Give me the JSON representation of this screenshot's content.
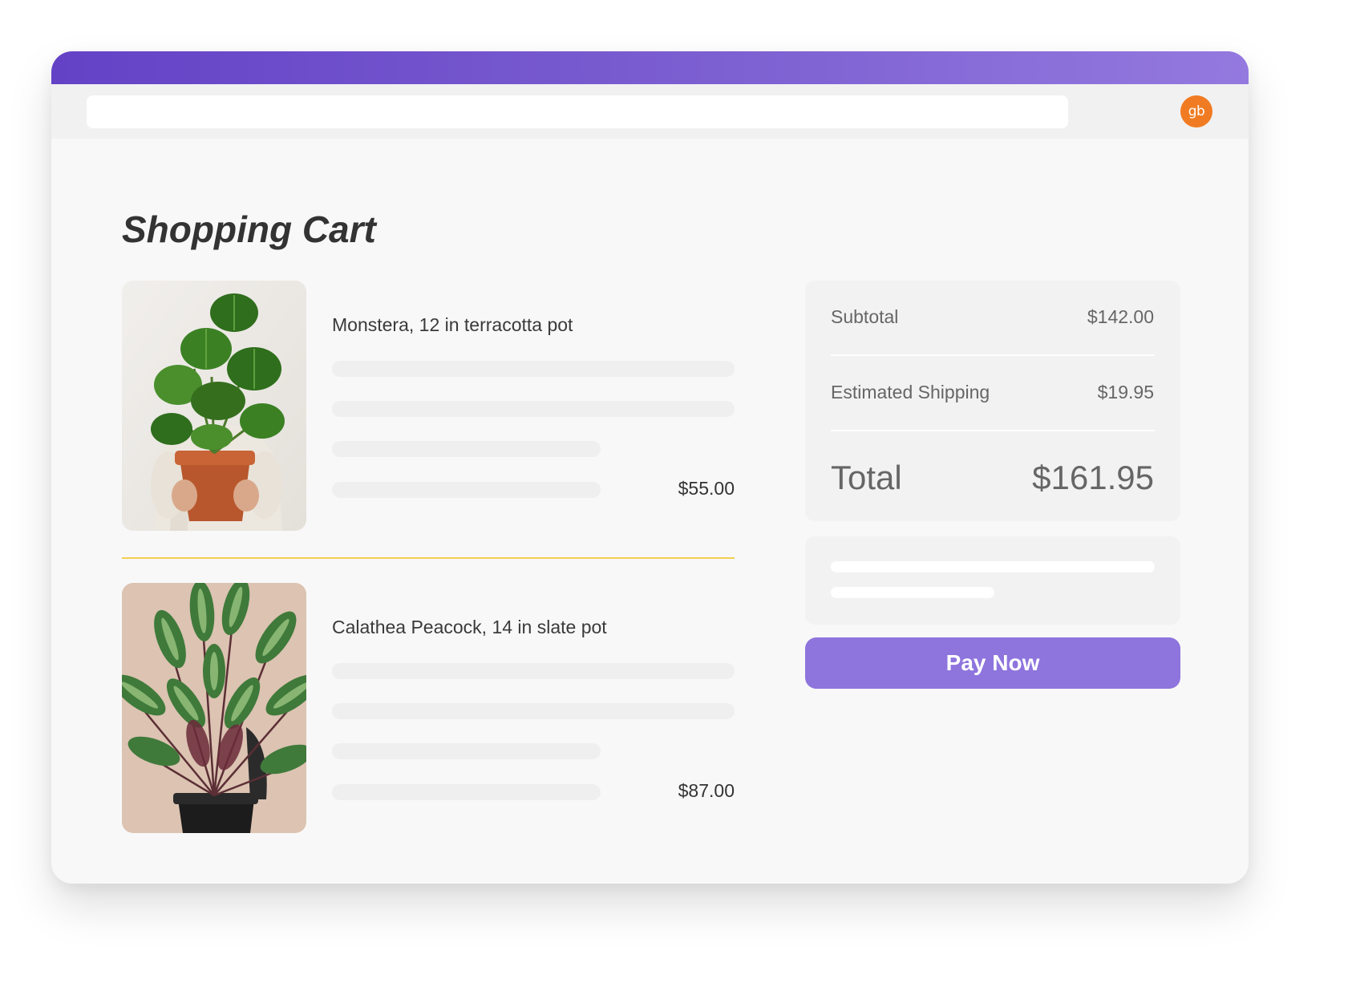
{
  "user": {
    "avatar_initials": "gb"
  },
  "page": {
    "title": "Shopping Cart"
  },
  "cart": {
    "items": [
      {
        "name": "Monstera, 12 in terracotta pot",
        "price": "$55.00"
      },
      {
        "name": "Calathea Peacock, 14 in slate pot",
        "price": "$87.00"
      }
    ]
  },
  "summary": {
    "subtotal_label": "Subtotal",
    "subtotal_value": "$142.00",
    "shipping_label": "Estimated Shipping",
    "shipping_value": "$19.95",
    "total_label": "Total",
    "total_value": "$161.95"
  },
  "actions": {
    "pay_label": "Pay Now"
  },
  "colors": {
    "header_gradient_start": "#6442c6",
    "header_gradient_end": "#9479df",
    "pay_button": "#8e74dd",
    "avatar": "#f07b22",
    "divider": "#f3cd52"
  }
}
